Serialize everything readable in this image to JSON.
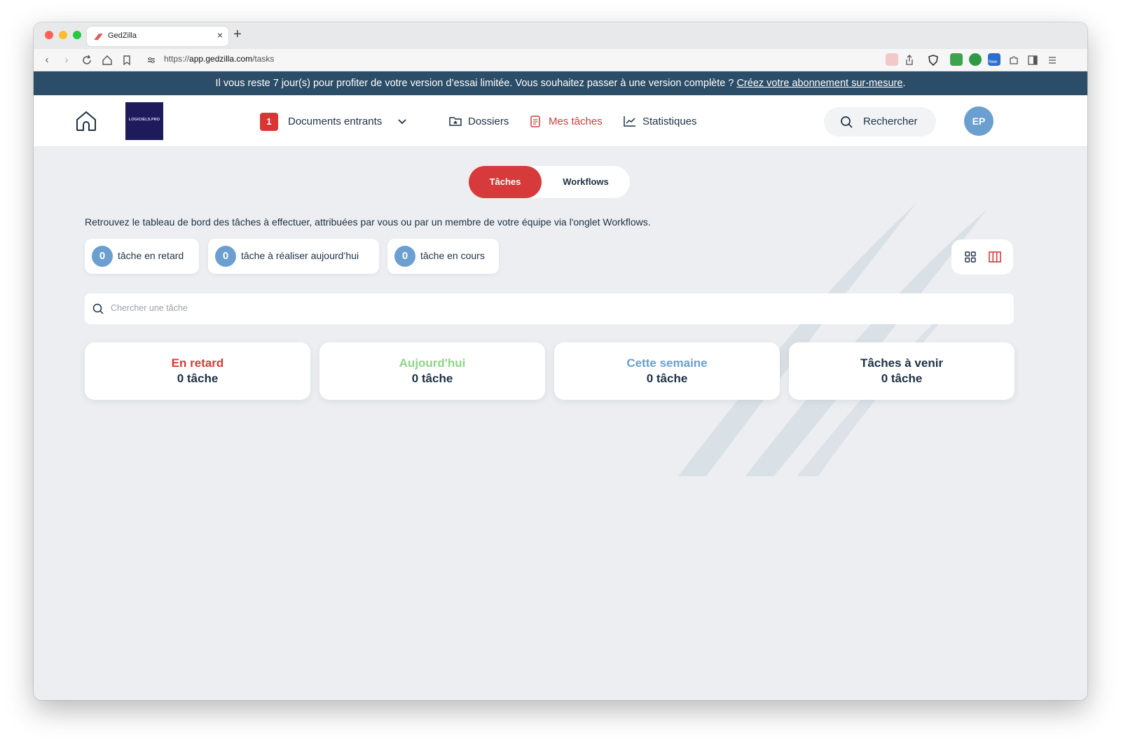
{
  "browser": {
    "tab_title": "GedZilla",
    "url_prefix": "https://",
    "url_host": "app.gedzilla.com",
    "url_path": "/tasks",
    "new_badge": "New"
  },
  "banner": {
    "text": "Il vous reste 7 jour(s) pour profiter de votre version d’essai limitée. Vous souhaitez passer à une version complète ? ",
    "link": "Créez votre abonnement sur-mesure",
    "suffix": "."
  },
  "nav": {
    "logo_text": "LOGICIELS.PRO",
    "incoming_count": "1",
    "incoming_label": "Documents entrants",
    "folders_label": "Dossiers",
    "tasks_label": "Mes tâches",
    "stats_label": "Statistiques",
    "search_label": "Rechercher",
    "avatar_initials": "EP"
  },
  "tabs": {
    "active": "Tâches",
    "inactive": "Workflows"
  },
  "intro": "Retrouvez le tableau de bord des tâches à effectuer, attribuées par vous ou par un membre de votre équipe via l'onglet Workflows.",
  "chips": [
    {
      "count": "0",
      "label": "tâche en retard"
    },
    {
      "count": "0",
      "label": "tâche à réaliser aujourd’hui"
    },
    {
      "count": "0",
      "label": "tâche en cours"
    }
  ],
  "search": {
    "placeholder": "Chercher une tâche"
  },
  "columns": [
    {
      "title": "En retard",
      "count": "0 tâche",
      "color": "#d63a3a"
    },
    {
      "title": "Aujourd'hui",
      "count": "0 tâche",
      "color": "#8fd48a"
    },
    {
      "title": "Cette semaine",
      "count": "0 tâche",
      "color": "#6a9fd0"
    },
    {
      "title": "Tâches à venir",
      "count": "0 tâche",
      "color": "#1d3145"
    }
  ],
  "colors": {
    "accent": "#d63a3a",
    "banner": "#2b4d67",
    "navy": "#1d3145",
    "blue": "#6a9fd0"
  }
}
